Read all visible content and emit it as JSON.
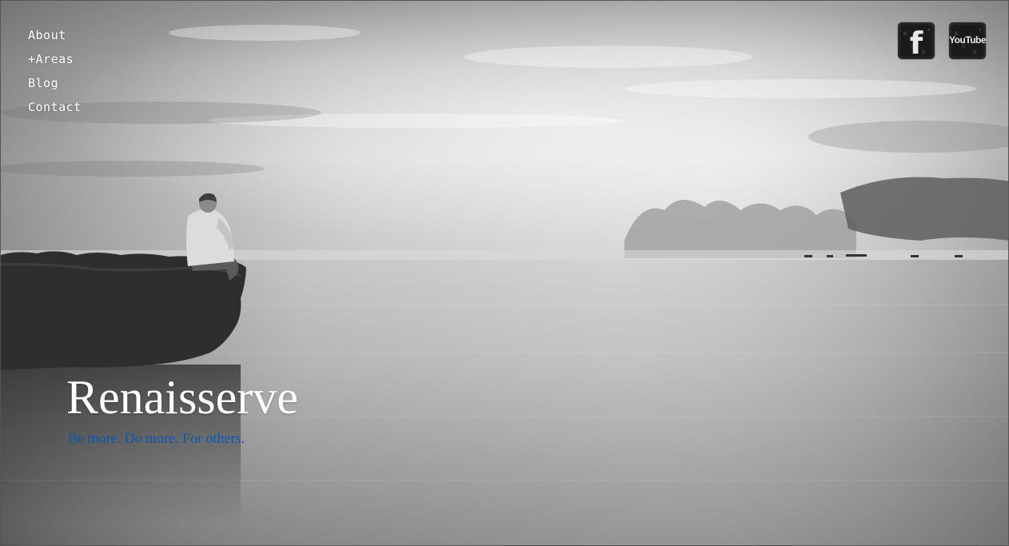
{
  "nav": {
    "items": [
      {
        "label": "About"
      },
      {
        "label": "+Areas"
      },
      {
        "label": "Blog"
      },
      {
        "label": "Contact"
      }
    ]
  },
  "social": {
    "facebook": {
      "glyph": "f",
      "icon": "facebook-icon"
    },
    "youtube": {
      "glyph": "YouTube",
      "icon": "youtube-icon"
    }
  },
  "hero": {
    "title": "Renaisserve",
    "tagline": "Be more. Do more. For others."
  },
  "colors": {
    "tagline": "#0a58b5",
    "nav_text": "#ffffff"
  }
}
